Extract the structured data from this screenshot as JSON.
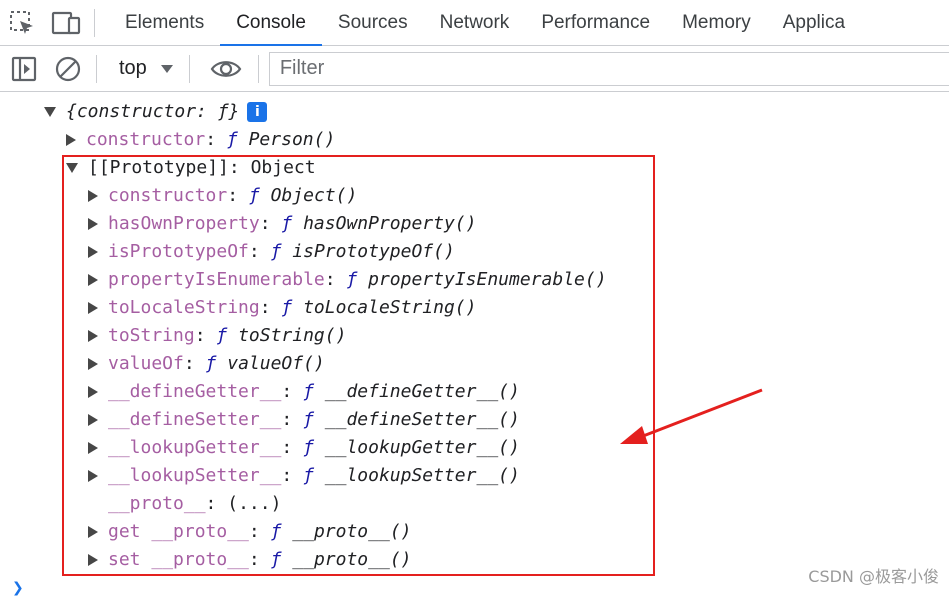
{
  "tabs": [
    {
      "label": "Elements",
      "active": false
    },
    {
      "label": "Console",
      "active": true
    },
    {
      "label": "Sources",
      "active": false
    },
    {
      "label": "Network",
      "active": false
    },
    {
      "label": "Performance",
      "active": false
    },
    {
      "label": "Memory",
      "active": false
    },
    {
      "label": "Applica",
      "active": false
    }
  ],
  "toolbar": {
    "context": "top",
    "filter_placeholder": "Filter"
  },
  "console": {
    "root_label": "{constructor: ƒ}",
    "info_badge": "i",
    "fn_mark": "ƒ",
    "constructor": {
      "key": "constructor",
      "value": "Person()"
    },
    "prototype": {
      "key": "[[Prototype]]",
      "value": "Object"
    },
    "proto_entries": [
      {
        "key": "constructor",
        "value": "Object()"
      },
      {
        "key": "hasOwnProperty",
        "value": "hasOwnProperty()"
      },
      {
        "key": "isPrototypeOf",
        "value": "isPrototypeOf()"
      },
      {
        "key": "propertyIsEnumerable",
        "value": "propertyIsEnumerable()"
      },
      {
        "key": "toLocaleString",
        "value": "toLocaleString()"
      },
      {
        "key": "toString",
        "value": "toString()"
      },
      {
        "key": "valueOf",
        "value": "valueOf()"
      },
      {
        "key": "__defineGetter__",
        "value": "__defineGetter__()"
      },
      {
        "key": "__defineSetter__",
        "value": "__defineSetter__()"
      },
      {
        "key": "__lookupGetter__",
        "value": "__lookupGetter__()"
      },
      {
        "key": "__lookupSetter__",
        "value": "__lookupSetter__()"
      }
    ],
    "proto_getter": {
      "key": "__proto__",
      "value": "(...)"
    },
    "get_proto": {
      "prefix": "get",
      "key": "__proto__",
      "value": "__proto__()"
    },
    "set_proto": {
      "prefix": "set",
      "key": "__proto__",
      "value": "__proto__()"
    }
  },
  "watermark": "CSDN @极客小俊",
  "colors": {
    "accent": "#1a73e8",
    "key": "#a55ea2",
    "highlight_box": "#e4201e"
  }
}
